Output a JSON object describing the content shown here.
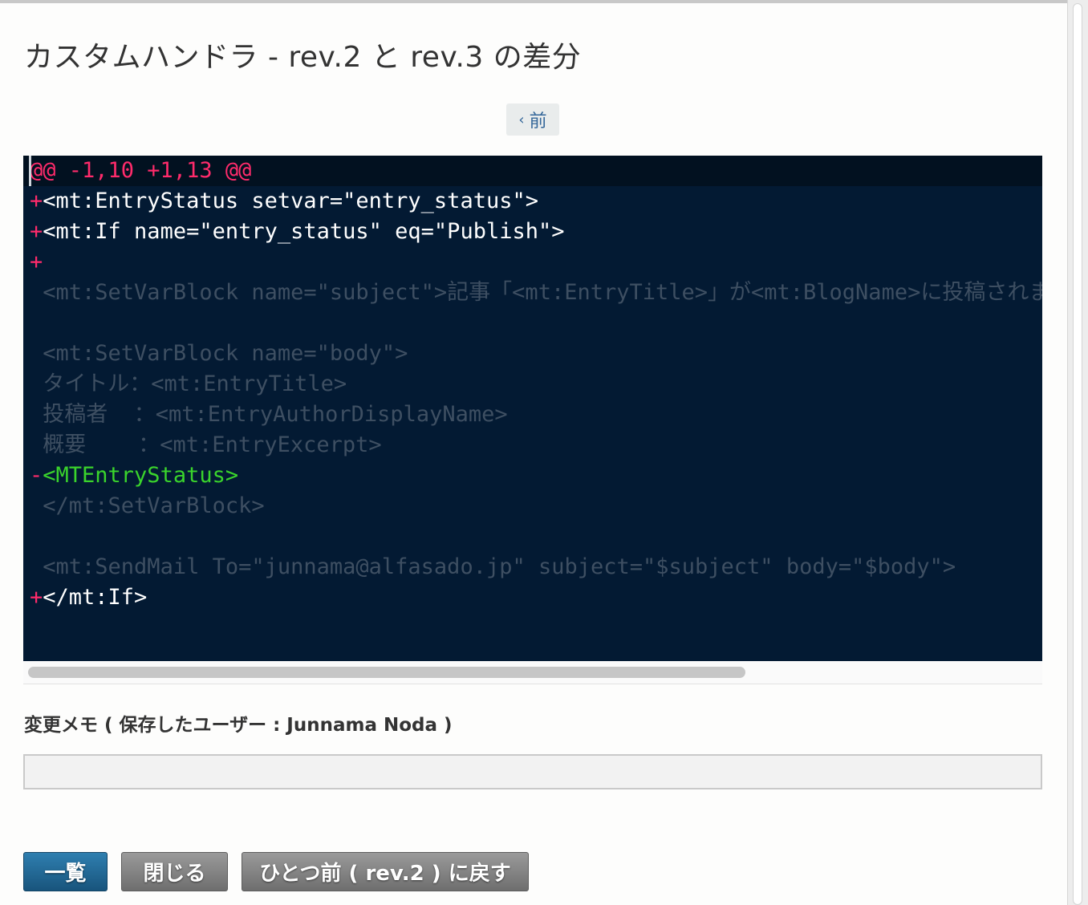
{
  "dialog": {
    "title": "カスタムハンドラ - rev.2 と rev.3 の差分"
  },
  "nav": {
    "prev_chevron": "‹",
    "prev_label": "前"
  },
  "diff": {
    "lines": [
      {
        "type": "hunk",
        "mark": "",
        "text": "@@ -1,10 +1,13 @@"
      },
      {
        "type": "add",
        "mark": "+",
        "text": "<mt:EntryStatus setvar=\"entry_status\">"
      },
      {
        "type": "add",
        "mark": "+",
        "text": "<mt:If name=\"entry_status\" eq=\"Publish\">"
      },
      {
        "type": "add",
        "mark": "+",
        "text": ""
      },
      {
        "type": "ctx",
        "mark": " ",
        "text": "<mt:SetVarBlock name=\"subject\">記事「<mt:EntryTitle>」が<mt:BlogName>に投稿されました</mt:SetVarBlock>"
      },
      {
        "type": "ctx",
        "mark": " ",
        "text": ""
      },
      {
        "type": "ctx",
        "mark": " ",
        "text": "<mt:SetVarBlock name=\"body\">"
      },
      {
        "type": "ctx",
        "mark": " ",
        "text": "タイトル：<mt:EntryTitle>"
      },
      {
        "type": "ctx",
        "mark": " ",
        "text": "投稿者  ：<mt:EntryAuthorDisplayName>"
      },
      {
        "type": "ctx",
        "mark": " ",
        "text": "概要    ：<mt:EntryExcerpt>"
      },
      {
        "type": "del",
        "mark": "-",
        "text": "<MTEntryStatus>"
      },
      {
        "type": "ctx",
        "mark": " ",
        "text": "</mt:SetVarBlock>"
      },
      {
        "type": "ctx",
        "mark": " ",
        "text": ""
      },
      {
        "type": "ctx",
        "mark": " ",
        "text": "<mt:SendMail To=\"junnama@alfasado.jp\" subject=\"$subject\" body=\"$body\">"
      },
      {
        "type": "add",
        "mark": "+",
        "text": "</mt:If>"
      }
    ]
  },
  "memo": {
    "label": "変更メモ ( 保存したユーザー : Junnama Noda )",
    "value": ""
  },
  "buttons": {
    "list_label": "一覧",
    "close_label": "閉じる",
    "revert_label": "ひとつ前 ( rev.2 ) に戻す"
  },
  "colors": {
    "diff_background": "#031a33",
    "hunk_color": "#ff2b6b",
    "deleted_color": "#3ad42c",
    "context_color": "#3e4f62",
    "primary_button": "#1f6592",
    "secondary_button": "#7f7f7f"
  }
}
